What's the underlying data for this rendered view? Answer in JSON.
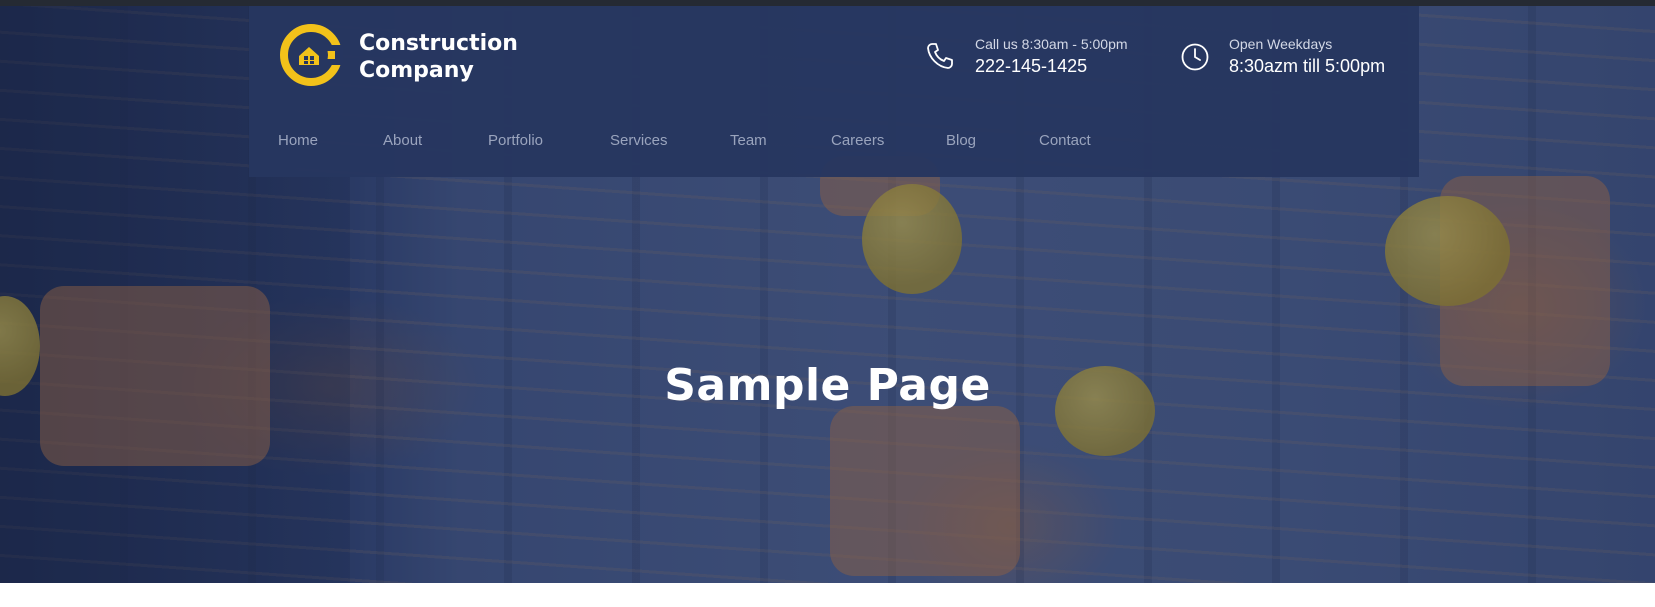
{
  "brand": {
    "name_line1": "Construction",
    "name_line2": "Company",
    "logo_icon": "wrench-house-icon",
    "accent_color": "#f2c21a"
  },
  "contact": {
    "phone": {
      "icon": "phone-icon",
      "label": "Call us 8:30am - 5:00pm",
      "value": "222-145-1425"
    },
    "hours": {
      "icon": "clock-icon",
      "label": "Open Weekdays",
      "value": "8:30azm till 5:00pm"
    }
  },
  "nav": {
    "items": [
      {
        "label": "Home"
      },
      {
        "label": "About"
      },
      {
        "label": "Portfolio"
      },
      {
        "label": "Services"
      },
      {
        "label": "Team"
      },
      {
        "label": "Careers"
      },
      {
        "label": "Blog"
      },
      {
        "label": "Contact"
      }
    ]
  },
  "hero": {
    "title": "Sample Page"
  },
  "colors": {
    "header_bg": "#263660",
    "nav_text": "#9aa4bd",
    "hero_overlay": "#2f4478"
  }
}
